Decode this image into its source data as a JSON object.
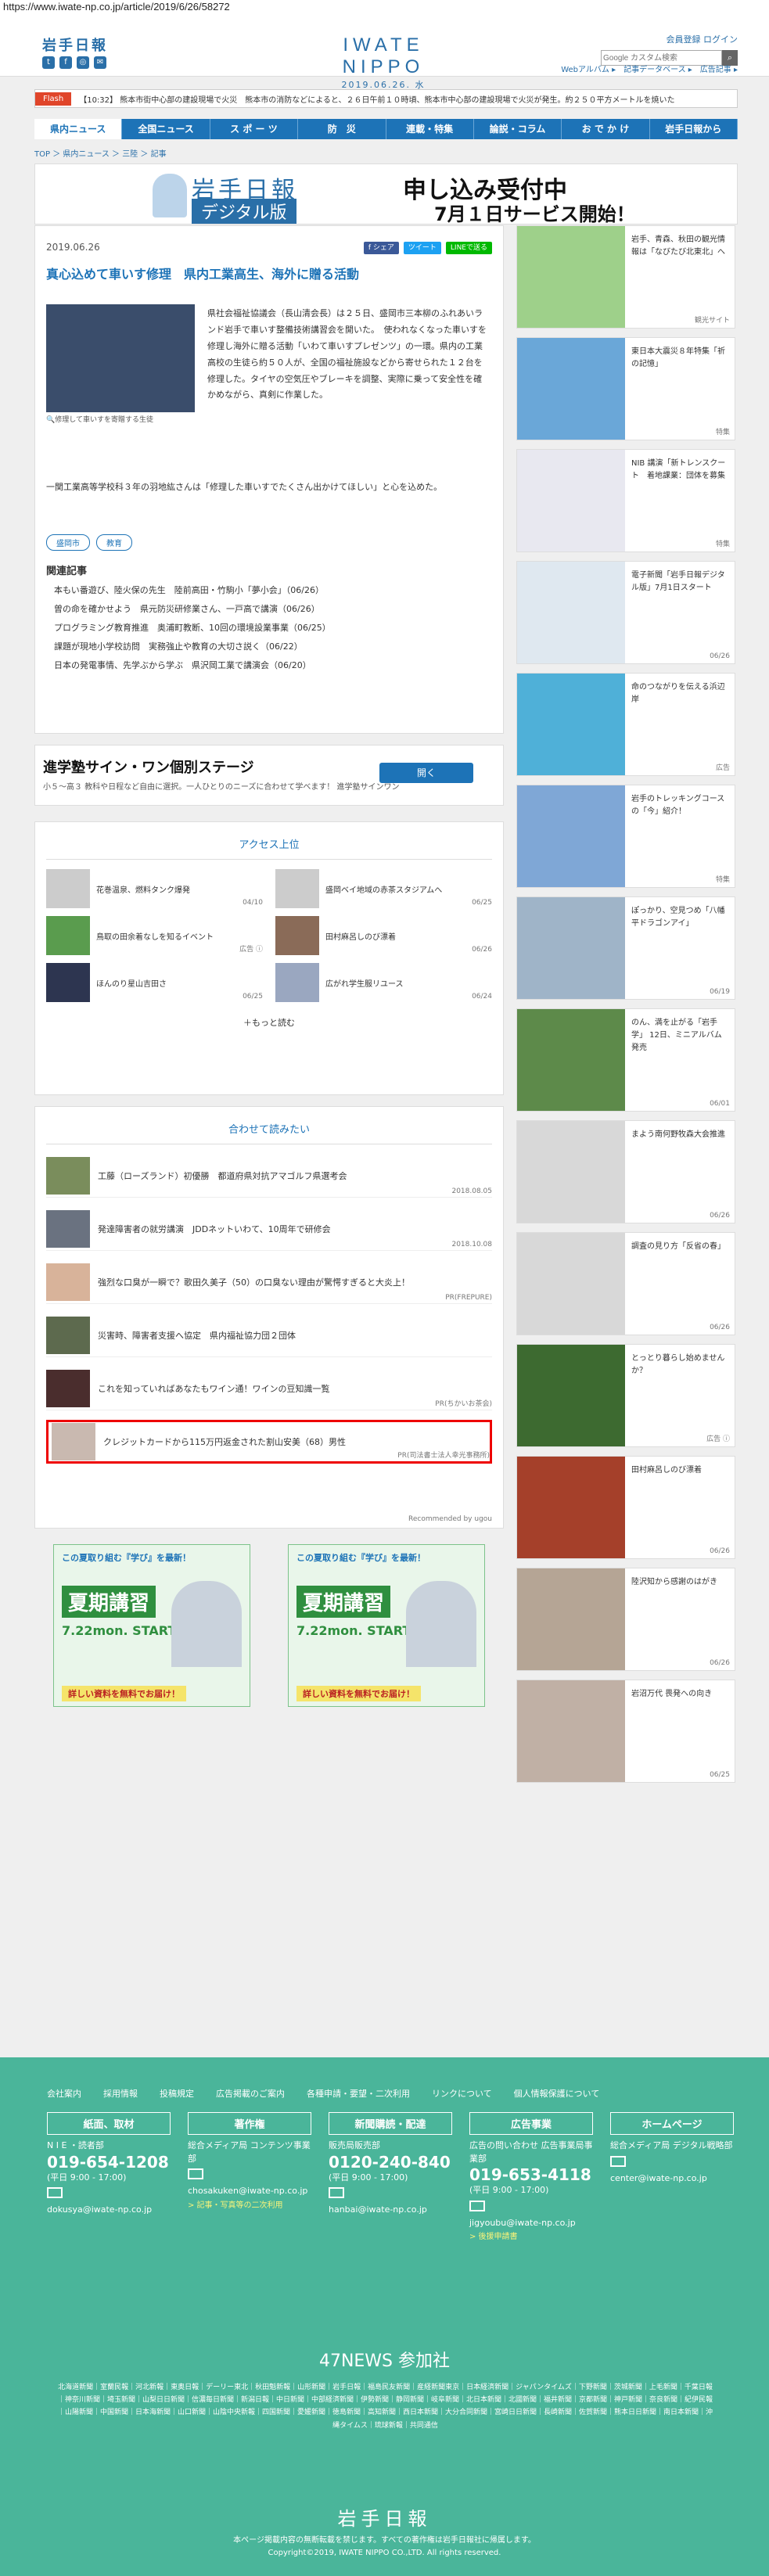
{
  "url": "https://www.iwate-np.co.jp/article/2019/6/26/58272",
  "header": {
    "brand": "岩手日報",
    "logo": "IWATE NIPPO",
    "date": "2019.06.26. 水",
    "links": "会員登録 ログイン",
    "search_placeholder": "Google カスタム検索",
    "sublinks": "Webアルバム ▸　記事データベース ▸　広告記事 ▸"
  },
  "flash": {
    "tag": "Flash",
    "text": "【10:32】 熊本市街中心部の建設現場で火災　熊本市の消防などによると、２６日午前１０時頃、熊本市中心部の建設現場で火災が発生。約２５０平方メートルを焼いた"
  },
  "nav": [
    "県内ニュース",
    "全国ニュース",
    "ス ポ ー ツ",
    "防　災",
    "連載・特集",
    "論説・コラム",
    "お で か け",
    "岩手日報から"
  ],
  "breadcrumb": "TOP ＞ 県内ニュース ＞ 三陸 ＞ 記事",
  "banner": {
    "a": "岩手日報",
    "b": "デジタル版",
    "c": "申し込み受付中",
    "d": "7月１日サービス開始！"
  },
  "article": {
    "date": "2019.06.26",
    "share": [
      "f シェア",
      "ツイート",
      "LINEで送る"
    ],
    "title": "真心込めて車いす修理　県内工業高生、海外に贈る活動",
    "caption": "修理して車いすを寄贈する生徒",
    "body1": "県社会福祉協議会（長山清会長）は２５日、盛岡市三本柳のふれあいランド岩手で車いす整備技術講習会を開いた。　使われなくなった車いすを修理し海外に贈る活動「いわて車いすプレゼンツ」の一環。県内の工業高校の生徒ら約５０人が、全国の福祉施設などから寄せられた１２台を修理した。タイヤの空気圧やブレーキを調整、実際に乗って安全性を確かめながら、真剣に作業した。",
    "body2": "一関工業高等学校科３年の羽地紘さんは「修理した車いすでたくさん出かけてほしい」と心を込めた。",
    "tags": [
      "盛岡市",
      "教育"
    ],
    "related_h": "関連記事",
    "related": [
      "本もい番遊び、陸火保の先生　陸前高田・竹駒小「夢小会」（06/26）",
      "曽の命を確かせよう　県元防災研修業さん、一戸高で講演（06/26）",
      "プログラミング教育推進　奥浦町教断、10回の環境設業事業（06/25）",
      "課題が現地小学校訪問　実務強止や教育の大切さ説く（06/22）",
      "日本の発電事情、先学ぶから学ぶ　県沢岡工業で講演会（06/20）"
    ]
  },
  "ad1": {
    "t1": "進学塾サイン・ワン個別ステージ",
    "t2": "小５〜高３ 教科や日程など自由に選択。一人ひとりのニーズに合わせて学べます！ 進学塾サインワン",
    "btn": "開く"
  },
  "ranking": {
    "title": "アクセス上位",
    "items": [
      {
        "t": "花巻温泉、燃料タンク爆発",
        "d": "04/10"
      },
      {
        "t": "盛岡ベイ地域の赤茶スタジアムへ",
        "d": "06/25"
      },
      {
        "t": "鳥取の田余着なしを知るイベント",
        "d": "広告 ⓘ"
      },
      {
        "t": "田村麻呂しのび漂着",
        "d": "06/26"
      },
      {
        "t": "ほんのり星山吉田さ",
        "d": "06/25"
      },
      {
        "t": "広がれ学生服リユース",
        "d": "06/24"
      }
    ],
    "more": "＋もっと読む"
  },
  "recommend": {
    "title": "合わせて読みたい",
    "items": [
      {
        "t": "工藤（ローズランド）初優勝　都道府県対抗アマゴルフ県選考会",
        "d": "2018.08.05"
      },
      {
        "t": "発達障害者の就労講演　JDDネットいわて、10周年で研修会",
        "d": "2018.10.08"
      },
      {
        "t": "強烈な口臭が一瞬で？歌田久美子（50）の口臭ない理由が驚愕すぎると大炎上！",
        "d": "PR(FREPURE)"
      },
      {
        "t": "災害時、障害者支援へ協定　県内福祉協力団２団体",
        "d": ""
      },
      {
        "t": "これを知っていればあなたもワイン通！ワインの豆知識一覧",
        "d": "PR(ちかいお茶会)"
      },
      {
        "t": "クレジットカードから115万円返金された割山安美（68）男性",
        "d": "PR(司法書士法人幸光事務所)"
      }
    ],
    "powered": "Recommended by ugou"
  },
  "ads2": [
    {
      "h1": "この夏取り組む『学び』を最新！",
      "h2": "夏期講習",
      "h3": "7.22mon. START",
      "h4": "詳しい資料を無料でお届け！"
    },
    {
      "h1": "この夏取り組む『学び』を最新！",
      "h2": "夏期講習",
      "h3": "7.22mon. START",
      "h4": "詳しい資料を無料でお届け！"
    }
  ],
  "sidebar": [
    {
      "t": "岩手、青森、秋田の観光情報は「なびたび北東北」へ",
      "d": "観光サイト"
    },
    {
      "t": "東日本大震災８年特集「祈の記憶」",
      "d": "特集"
    },
    {
      "t": "NIB 講演「新トレンスクート　着地課業：団体を募集",
      "d": "特集"
    },
    {
      "t": "電子新聞「岩手日報デジタル版」7月1日スタート",
      "d": "06/26"
    },
    {
      "t": "命のつながりを伝える浜辺岸",
      "d": "広告"
    },
    {
      "t": "岩手のトレッキングコースの「今」紹介！",
      "d": "特集"
    },
    {
      "t": "ぽっかり、空見つめ「八幡平ドラゴンアイ」",
      "d": "06/19"
    },
    {
      "t": "のん、満を止がる「岩手学」 12日、ミニアルバム発売",
      "d": "06/01"
    },
    {
      "t": "まよう南何野牧森大会推進",
      "d": "06/26"
    },
    {
      "t": "調査の見り方「反省の春」",
      "d": "06/26"
    },
    {
      "t": "とっとり暮らし始めませんか？",
      "d": "広告 ⓘ"
    },
    {
      "t": "田村麻呂しのび漂着",
      "d": "06/26"
    },
    {
      "t": "陸沢知から感謝のはがき",
      "d": "06/26"
    },
    {
      "t": "岩沼万代 畏発への向き",
      "d": "06/25"
    }
  ],
  "footer": {
    "links": [
      "会社案内",
      "採用情報",
      "投稿規定",
      "広告掲載のご案内",
      "各種申請・要望・二次利用",
      "リンクについて",
      "個人情報保護について"
    ],
    "cols": [
      {
        "h": "紙面、取材",
        "l1": "N I E ・読者部",
        "tel": "019-654-1208",
        "hrs": "(平日 9:00 - 17:00)",
        "mail": "dokusya@iwate-np.co.jp",
        "yl": ""
      },
      {
        "h": "著作権",
        "l1": "総合メディア局 コンテンツ事業部",
        "tel": "",
        "hrs": "",
        "mail": "chosakuken@iwate-np.co.jp",
        "yl": "> 記事・写真等の二次利用"
      },
      {
        "h": "新聞購読・配達",
        "l1": "販売局販売部",
        "tel": "0120-240-840",
        "hrs": "(平日 9:00 - 17:00)",
        "mail": "hanbai@iwate-np.co.jp",
        "yl": ""
      },
      {
        "h": "広告事業",
        "l1": "広告の問い合わせ 広告事業局事業部",
        "tel": "019-653-4118",
        "hrs": "(平日 9:00 - 17:00)",
        "mail": "jigyoubu@iwate-np.co.jp",
        "yl": "> 後援申請書"
      },
      {
        "h": "ホームページ",
        "l1": "総合メディア局 デジタル戦略部",
        "tel": "",
        "hrs": "",
        "mail": "center@iwate-np.co.jp",
        "yl": ""
      }
    ],
    "n47_title": "47NEWS 参加社",
    "n47_list": "北海道新聞｜室蘭民報｜河北新報｜東奥日報｜デーリー東北｜秋田魁新報｜山形新聞｜岩手日報｜福島民友新聞｜産経新聞東京｜日本経済新聞｜ジャパンタイムズ｜下野新聞｜茨城新聞｜上毛新聞｜千葉日報｜神奈川新聞｜埼玉新聞｜山梨日日新聞｜信濃毎日新聞｜新潟日報｜中日新聞｜中部経済新聞｜伊勢新聞｜静岡新聞｜岐阜新聞｜北日本新聞｜北國新聞｜福井新聞｜京都新聞｜神戸新聞｜奈良新聞｜紀伊民報｜山陽新聞｜中国新聞｜日本海新聞｜山口新聞｜山陰中央新報｜四国新聞｜愛媛新聞｜徳島新聞｜高知新聞｜西日本新聞｜大分合同新聞｜宮崎日日新聞｜長崎新聞｜佐賀新聞｜熊本日日新聞｜南日本新聞｜沖縄タイムス｜琉球新報｜共同通信",
    "logo": "岩手日報",
    "note1": "本ページ掲載内容の無断転載を禁じます。すべての著作権は岩手日報社に帰属します。",
    "note2": "Copyright©2019, IWATE NIPPO CO.,LTD. All rights reserved."
  }
}
